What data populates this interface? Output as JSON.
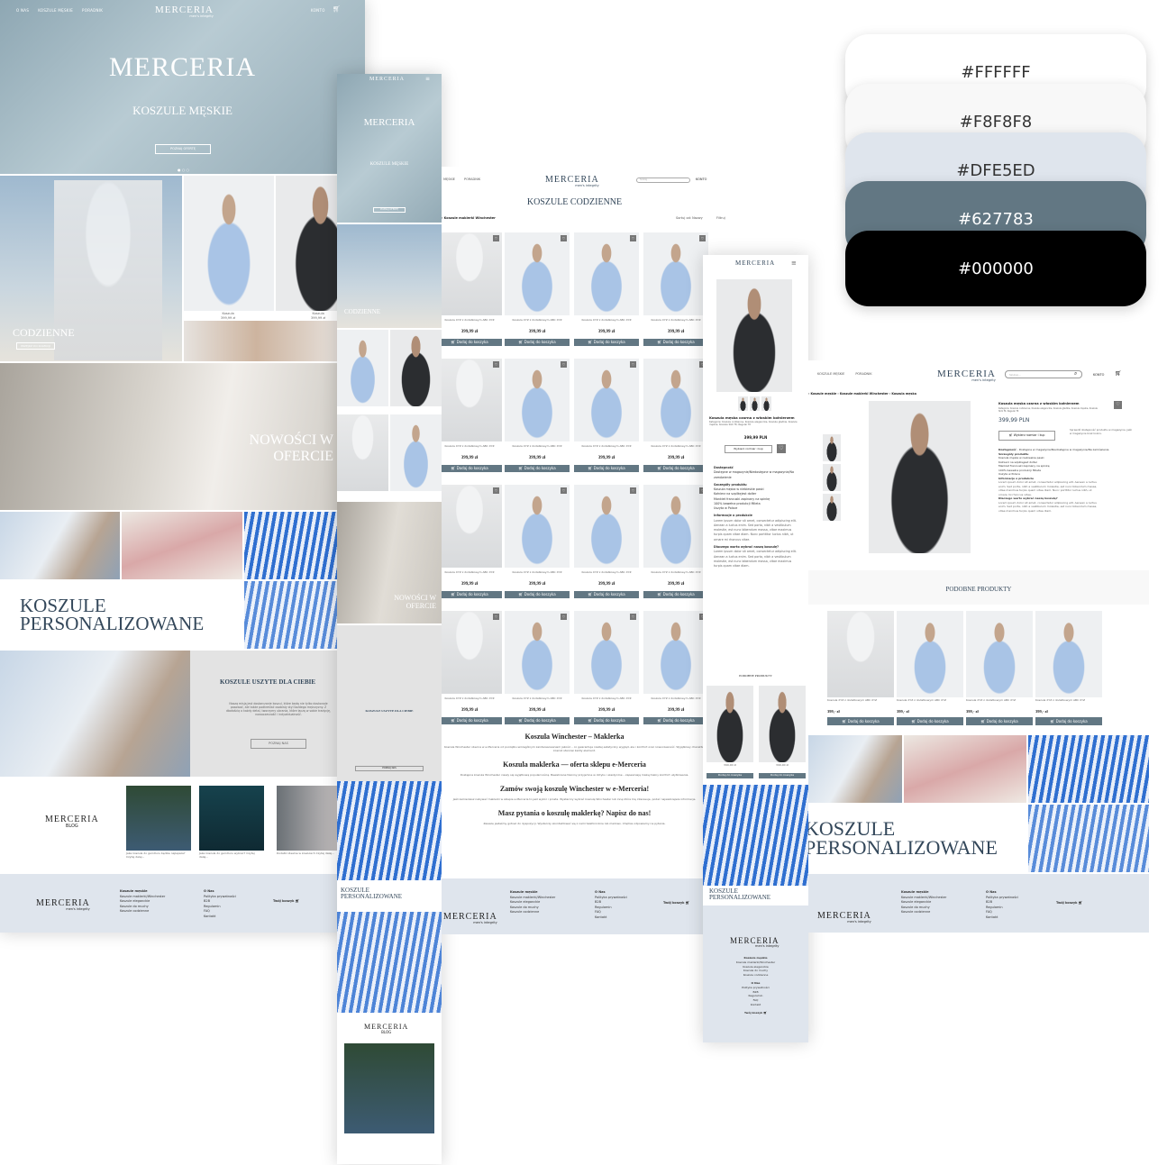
{
  "palette": [
    "#FFFFFF",
    "#F8F8F8",
    "#DFE5ED",
    "#627783",
    "#000000"
  ],
  "brand": {
    "name": "MERCERIA",
    "tagline": "men's integrity",
    "blog": "BLOG"
  },
  "home": {
    "nav": [
      "O NAS",
      "KOSZULE MĘSKIE",
      "PORADNIK"
    ],
    "account": "KONTO",
    "hero_title": "MERCERIA",
    "hero_subtitle": "KOSZULE MĘSKIE",
    "hero_button": "POZNAJ OFERTĘ",
    "category_title": "CODZIENNE",
    "category_button": "PRZEJDŹ DO KOLEKCJI",
    "product_labels": [
      {
        "name": "Koszula",
        "price": "399,99 zł"
      },
      {
        "name": "Koszula",
        "price": "399,99 zł"
      }
    ],
    "new_title": "NOWOŚCI W OFERCIE",
    "personal_title_1": "KOSZULE",
    "personal_title_2": "PERSONALIZOWANE",
    "tailored_title": "KOSZULE USZYTE DLA CIEBIE",
    "tailored_text": "Naszą misją jest dostarczanie koszul, które będą nie tylko doskonale pasować, ale także podkreślać osobisty styl każdego mężczyzny. Z dbałością o każdy detal, tworzymy ubrania, które łączą w sobie tradycję, nowoczesność i indywidualność.",
    "tailored_button": "POZNAJ NAS",
    "blog_posts": [
      "Jaka koszula do garnituru będzie najlepsza? Czytaj dalej...",
      "Jaka koszula do garnituru wybrać? Czytaj dalej...",
      "Dodatki idealne w koszulach Czytaj dalej..."
    ]
  },
  "footer": {
    "col1_title": "Koszule męskie",
    "col1": [
      "Koszule maklerki/Winchester",
      "Koszule eleganckie",
      "Koszule do muchy",
      "Koszule codzienne"
    ],
    "col2_title": "O Nas",
    "col2": [
      "Polityka prywatności",
      "B2B",
      "Regulamin",
      "FAQ",
      "Kontakt"
    ],
    "cart": "Twój koszyk"
  },
  "category": {
    "nav": [
      "MĘSKIE",
      "PORADNIK"
    ],
    "search_placeholder": "Szukaj...",
    "account": "KONTO",
    "title": "KOSZULE CODZIENNE",
    "breadcrumb": "› Koszule maklerki Winchester",
    "sort": "Sortuj od: Nazwy",
    "filter": "Filtruj",
    "product_name": "Koszula XYZ z dodatkowym ABC XYZ",
    "product_price": "399,99 zł",
    "add_to_cart": "Dodaj do koszyka",
    "seo": [
      {
        "h": "Koszula Winchester – Maklerka",
        "p": "Koszula Winchester obecna w e-Merceria od początku szczególnym zainteresowaniem jakości – co gwarantuje niezłej estetyczny wygląd, ale i komfort oraz nowoczesność. Wyjątkowy charakter koszuli stanowi każdy element."
      },
      {
        "h": "Koszula maklerka — oferta sklepu e-Merceria",
        "p": "Dostępna koszula Winchester cieszy się wyjątkową popularnością. Bawełniane tkaniny przyjemne w dotyku i elastyczne – zapewniają maksymalny komfort użytkowania."
      },
      {
        "h": "Zamów swoją koszulę Winchester w e-Merceria!",
        "p": "Jeśli zamierzasz nabywać maklerki w sklepie e-Merceria to jest wybór i prosta. Wystarczy wybrać koszulę Winchester lub inną która Cię interesuje, podać najważniejsze informacje."
      },
      {
        "h": "Masz pytania o koszulę maklerkę? Napisz do nas!",
        "p": "Zawsze jesteśmy gotowi do dyspozycji. Wystarczy skontaktować się z nami telefonicznie lub mailowo. Chętnie odpowiemy na pytania."
      }
    ]
  },
  "product": {
    "nav": [
      "KOSZULE MĘSKIE",
      "PORADNIK"
    ],
    "search_placeholder": "Szukaj...",
    "account": "KONTO",
    "breadcrumb": "› Koszule męskie › Koszule maklerki Winchester › Koszula męska",
    "name": "Koszula męska czarna z włoskim kołnierzem",
    "categories": "Kategorie: Koszule codzienne, Koszule eleganckie, Koszule gładkie, Koszule męskie, Koszule Slim fit, Regular fit",
    "price": "399,99 PLN",
    "select_size": "Wybierz rozmiar i kup",
    "store_note": "Sprawdź dostępność produktu w magazynie. Jeśli w magazynie brak koloru.",
    "availability_label": "Dostępność",
    "availability": "Dostępne w magazynie/Niedostępne w magazynie/Na zamówienie",
    "details_title": "Szczegóły produktu",
    "details": [
      "Koszula męska w niebieskie paski",
      "Kołnierz na szpilkęjest dolter",
      "Mankiet francuski zapinany na spinkę",
      "100% bawełna produkcji Mileta",
      "Uszyta w Polsce"
    ],
    "info_title": "Informacje o produkcie",
    "info_text": "Lorem ipsum dolor sit amet, consectetur adipiscing elit. Aenean a luctus enim. Sed porta, nibh a vestibulum molestie, est nunc bibendum massa, vitae maximus turpis quam vitae diam. Nunc porttitor luctus nibh, ut ornare mi rhoncus vitae.",
    "why_title": "Dlaczego warto wybrać naszą koszulę?",
    "why_text": "Lorem ipsum dolor sit amet, consectetur adipiscing elit. Aenean a luctus enim. Sed porta, nibh a vestibulum molestie, est nunc bibendum massa, vitae maximus turpis quam vitae diam.",
    "similar_title": "PODOBNE PRODUKTY",
    "similar_name": "Koszula XYZ z dodatkowym ABC XYZ",
    "similar_price": "399,- zł",
    "mobile_price": "399,00 zł"
  }
}
